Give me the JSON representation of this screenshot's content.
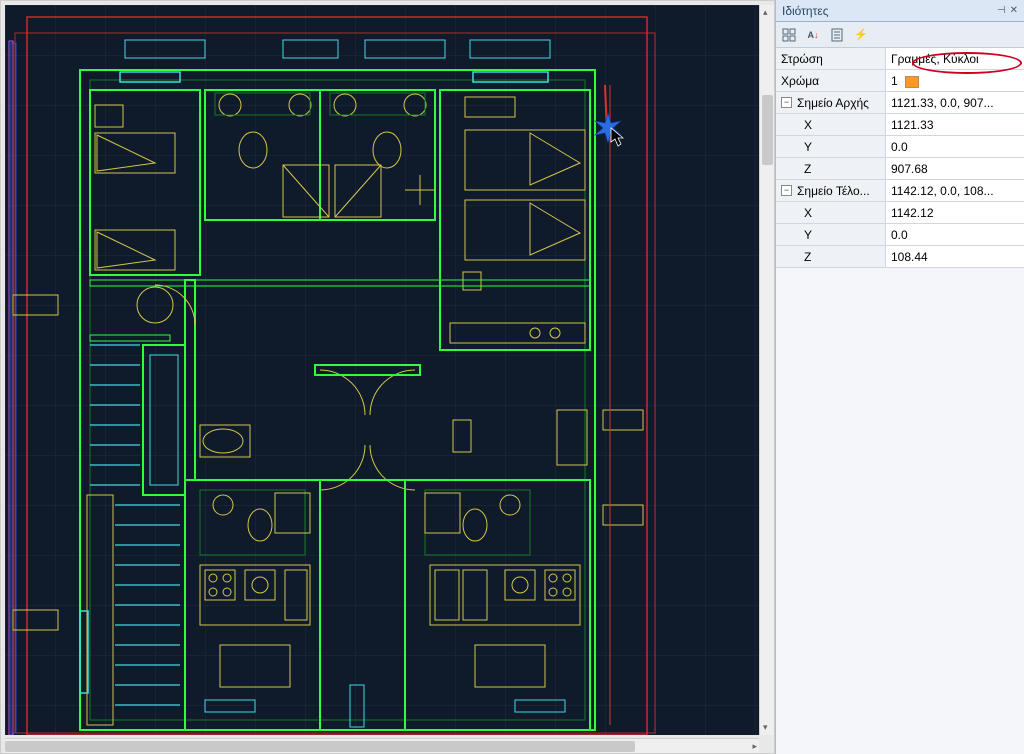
{
  "panel": {
    "title": "Ιδιότητες",
    "toolbar_tips": {
      "categorize": "⊞",
      "az_sort": "A↓Z",
      "page": "▤",
      "bolt": "⚡"
    },
    "rows": {
      "layer_label": "Στρώση",
      "layer_value": "Γραμμές, Κύκλοι",
      "color_label": "Χρώμα",
      "color_value": "1",
      "start_label": "Σημείο Αρχής",
      "start_value": "1121.33, 0.0, 907...",
      "start_x_label": "X",
      "start_x_value": "1121.33",
      "start_y_label": "Y",
      "start_y_value": "0.0",
      "start_z_label": "Z",
      "start_z_value": "907.68",
      "end_label": "Σημείο Τέλο...",
      "end_value": "1142.12, 0.0, 108...",
      "end_x_label": "X",
      "end_x_value": "1142.12",
      "end_y_label": "Y",
      "end_y_value": "0.0",
      "end_z_label": "Z",
      "end_z_value": "108.44"
    }
  },
  "colors": {
    "wall_green": "#2dff3a",
    "dim_green": "#167a28",
    "yellow": "#d4c74a",
    "red": "#e03030",
    "cyan": "#3fd9e6",
    "blue": "#2a4bd8",
    "magenta": "#c04fd0",
    "cursor_blue": "#2a6be0"
  }
}
